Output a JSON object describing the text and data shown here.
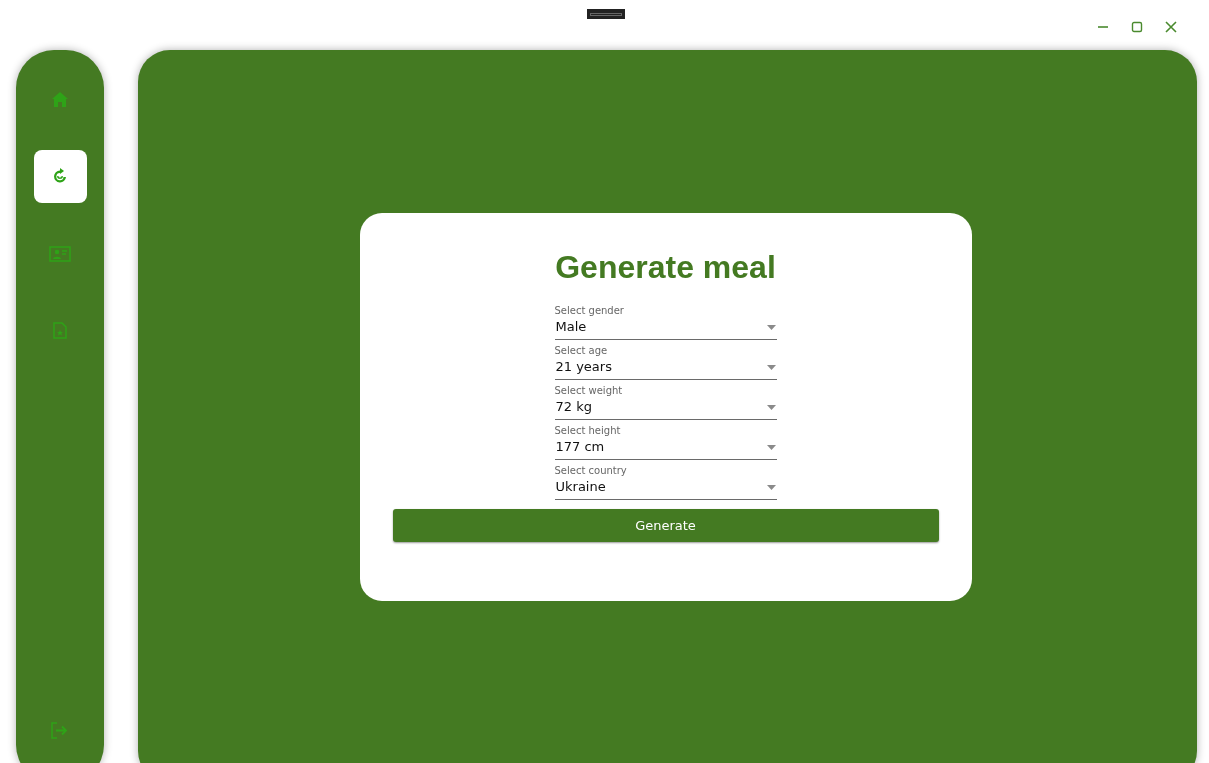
{
  "nav": [
    {
      "kind": "home",
      "selected": false
    },
    {
      "kind": "meal",
      "selected": true
    },
    {
      "kind": "profile",
      "selected": false
    },
    {
      "kind": "document",
      "selected": false
    }
  ],
  "nav_bottom": [
    {
      "kind": "logout",
      "selected": false
    }
  ],
  "form": {
    "title": "Generate meal",
    "fields": [
      {
        "label": "Select gender",
        "value": "Male"
      },
      {
        "label": "Select age",
        "value": "21 years"
      },
      {
        "label": "Select weight",
        "value": "72 kg"
      },
      {
        "label": "Select height",
        "value": "177 cm"
      },
      {
        "label": "Select country",
        "value": "Ukraine"
      }
    ],
    "button": "Generate"
  }
}
